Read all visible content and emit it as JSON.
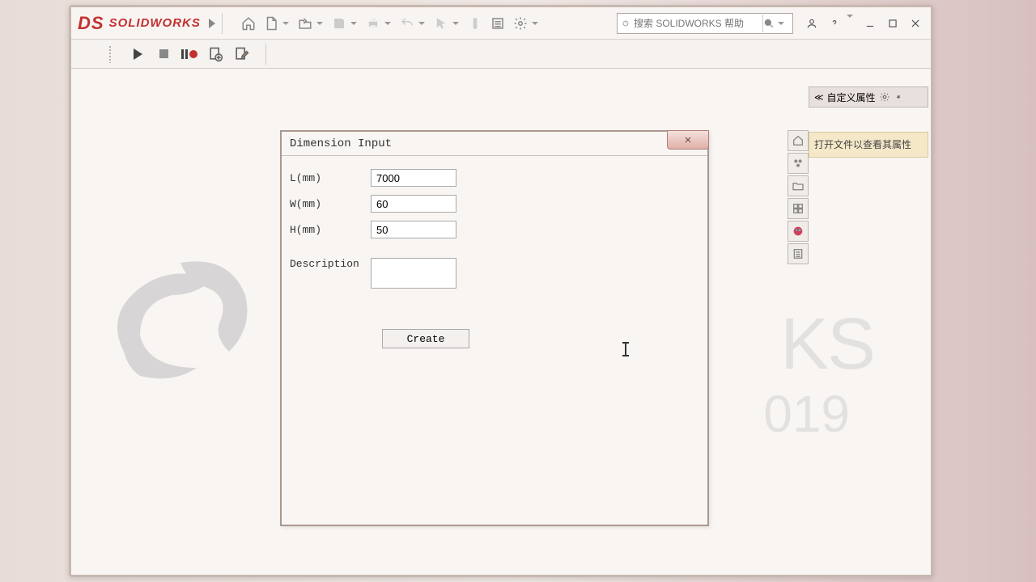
{
  "app": {
    "name": "SOLIDWORKS",
    "year_watermark": "019"
  },
  "search": {
    "placeholder": "搜索 SOLIDWORKS 帮助"
  },
  "right_panel": {
    "title": "自定义属性",
    "note": "打开文件以查看其属性"
  },
  "dialog": {
    "title": "Dimension Input",
    "fields": {
      "length": {
        "label": "L(mm)",
        "value": "7000"
      },
      "width": {
        "label": "W(mm)",
        "value": "60"
      },
      "height": {
        "label": "H(mm)",
        "value": "50"
      },
      "description": {
        "label": "Description",
        "value": ""
      }
    },
    "create_button": "Create"
  }
}
